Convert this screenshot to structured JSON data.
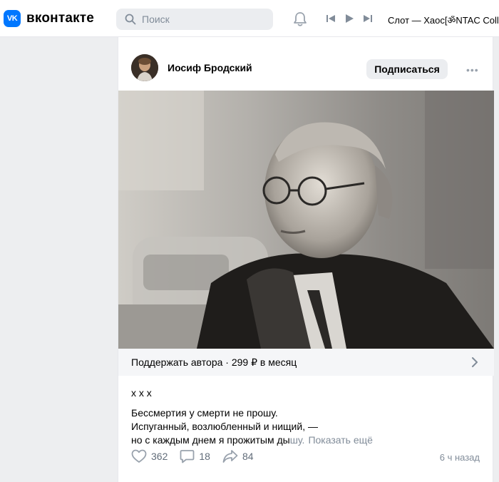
{
  "header": {
    "logo_mark": "VK",
    "logo_text": "вконтакте",
    "search_placeholder": "Поиск",
    "player_track": "Слот — Хаос[ॐNTAC Collection]"
  },
  "post": {
    "author_name": "Иосиф Бродский",
    "subscribe_label": "Подписаться",
    "more_label": "•••",
    "support_label": "Поддержать автора · 299 ₽ в месяц",
    "text_title": "х х х",
    "text_lines": [
      "Бессмертия у смерти не прошу.",
      "Испуганный, возлюбленный и нищий, —",
      "но с каждым днем я прожитым дышу."
    ],
    "text_line3_main": "но с каждым днем я прожитым ды",
    "text_line3_fade": "шу.",
    "show_more_label": "Показать ещё",
    "likes": "362",
    "comments": "18",
    "shares": "84",
    "time": "6 ч назад"
  },
  "colors": {
    "accent": "#0077ff",
    "background": "#edeef0",
    "secondary_text": "#818c99",
    "icon": "#99a2ad"
  },
  "icons": [
    "search-icon",
    "bell-icon",
    "prev-track-icon",
    "play-icon",
    "next-track-icon",
    "more-icon",
    "chevron-right-icon",
    "like-icon",
    "comment-icon",
    "share-icon"
  ]
}
